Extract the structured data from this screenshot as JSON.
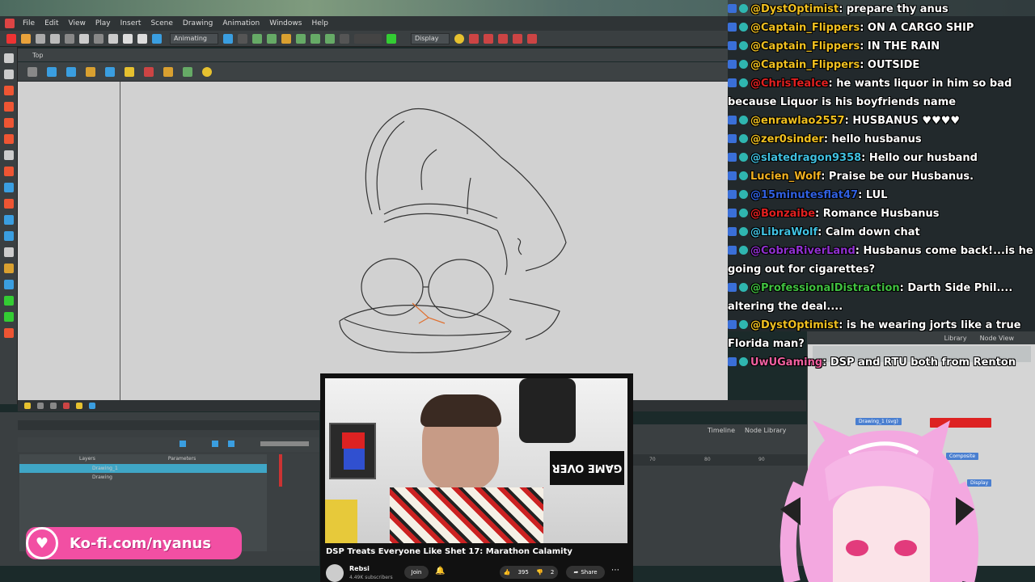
{
  "menu": {
    "items": [
      "File",
      "Edit",
      "View",
      "Play",
      "Insert",
      "Scene",
      "Drawing",
      "Animation",
      "Windows",
      "Help"
    ]
  },
  "toolbar": {
    "mode": "Animating",
    "display": "Display"
  },
  "camera": {
    "tab": "Top"
  },
  "timeline": {
    "layers_header": "Layers",
    "params_header": "Parameters",
    "layers": [
      {
        "name": "Drawing_1",
        "selected": true
      },
      {
        "name": "Drawing",
        "selected": false
      }
    ]
  },
  "right_panel": {
    "tabs": [
      "Timeline",
      "Node Library"
    ],
    "node_tabs": [
      "Library",
      "Node View"
    ],
    "ruler": [
      "70",
      "80",
      "90"
    ],
    "nodes": [
      "Drawing_1 (svg)",
      "Composite",
      "Display"
    ]
  },
  "chat": [
    {
      "user": "@DystOptimist",
      "msg": ": prepare thy anus",
      "color": "#f0c020"
    },
    {
      "user": "@Captain_Flippers",
      "msg": ": ON A CARGO SHIP",
      "color": "#f0c020"
    },
    {
      "user": "@Captain_Flippers",
      "msg": ": IN THE RAIN",
      "color": "#f0c020"
    },
    {
      "user": "@Captain_Flippers",
      "msg": ": OUTSIDE",
      "color": "#f0c020"
    },
    {
      "user": "@ChrisTeaIce",
      "msg": ": he wants liquor in him so bad because Liquor is his boyfriends name",
      "color": "#e02020",
      "wrap": true
    },
    {
      "user": "@enrawlao2557",
      "msg": ": HUSBANUS ♥♥♥♥",
      "color": "#f0c020"
    },
    {
      "user": "@zer0sinder",
      "msg": ": hello husbanus",
      "color": "#f0c020"
    },
    {
      "user": "@slatedragon9358",
      "msg": ": Hello our husband",
      "color": "#40c0e0"
    },
    {
      "user": "Lucien_Wolf",
      "msg": ": Praise be our Husbanus.",
      "color": "#f0b020"
    },
    {
      "user": "@15minutesflat47",
      "msg": ": LUL",
      "color": "#3060e0"
    },
    {
      "user": "@Bonzaibe",
      "msg": ": Romance Husbanus",
      "color": "#e02020"
    },
    {
      "user": "@LibraWolf",
      "msg": ": Calm down chat",
      "color": "#40c0e0"
    },
    {
      "user": "@CobraRiverLand",
      "msg": ": Husbanus come back!...is he going out for cigarettes?",
      "color": "#9030d0",
      "wrap": true
    },
    {
      "user": "@ProfessionalDistraction",
      "msg": ": Darth Side Phil.... altering the deal....",
      "color": "#40c040",
      "wrap": true
    },
    {
      "user": "@DystOptimist",
      "msg": ": is he wearing jorts like a true Florida man?",
      "color": "#f0c020",
      "wrap": true
    },
    {
      "user": "UwUGaming",
      "msg": ": DSP and RTU both from Renton",
      "color": "#f060a0",
      "wrap": true
    }
  ],
  "video": {
    "title": "DSP Treats Everyone Like Shet 17: Marathon Calamity",
    "channel": "Rebsi",
    "subs": "4.49K subscribers",
    "join": "Join",
    "likes": "395",
    "dislikes": "2",
    "share": "Share",
    "overlay_text": "GAME OVER"
  },
  "kofi": {
    "text": "Ko-fi.com/nyanus"
  },
  "colors": {
    "accent_pink": "#f24fa3",
    "selected_layer": "#3fa6c6"
  }
}
